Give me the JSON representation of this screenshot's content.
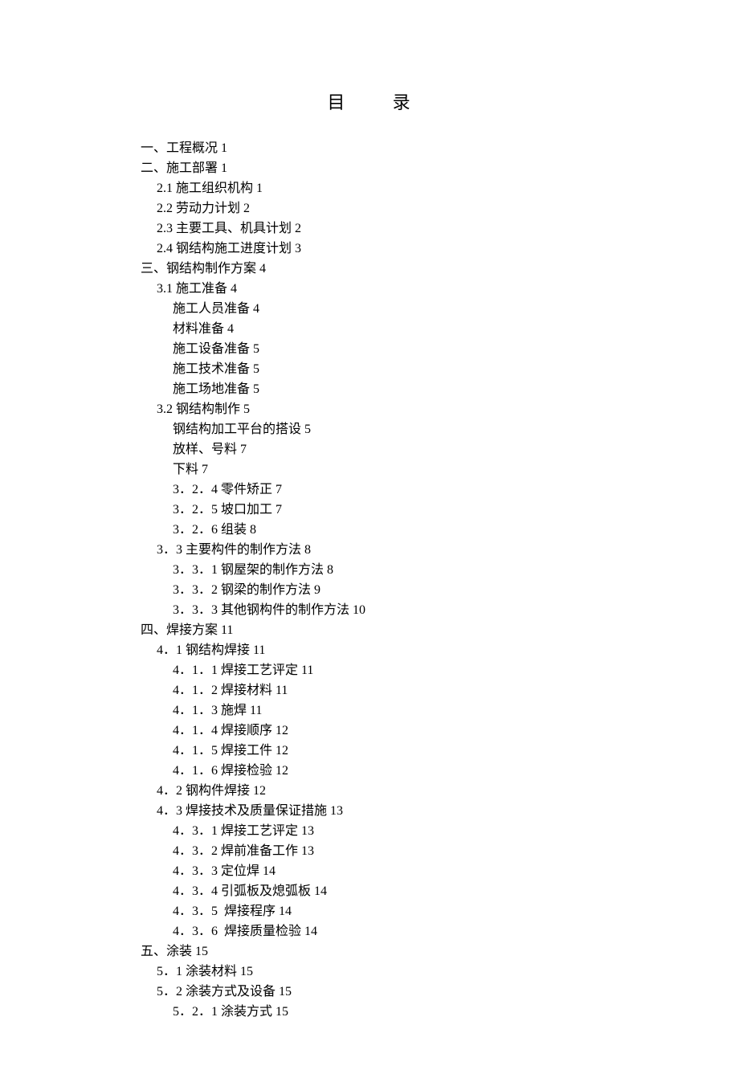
{
  "title_a": "目",
  "title_b": "录",
  "toc": [
    {
      "level": 0,
      "text": "一、工程概况 1"
    },
    {
      "level": 0,
      "text": "二、施工部署 1"
    },
    {
      "level": 1,
      "text": "2.1 施工组织机构 1"
    },
    {
      "level": 1,
      "text": "2.2 劳动力计划 2"
    },
    {
      "level": 1,
      "text": "2.3 主要工具、机具计划 2"
    },
    {
      "level": 1,
      "text": "2.4 钢结构施工进度计划 3"
    },
    {
      "level": 0,
      "text": "三、钢结构制作方案 4"
    },
    {
      "level": 1,
      "text": "3.1 施工准备 4"
    },
    {
      "level": 2,
      "text": "施工人员准备 4"
    },
    {
      "level": 2,
      "text": "材料准备 4"
    },
    {
      "level": 2,
      "text": "施工设备准备 5"
    },
    {
      "level": 2,
      "text": "施工技术准备 5"
    },
    {
      "level": 2,
      "text": "施工场地准备 5"
    },
    {
      "level": 1,
      "text": "3.2 钢结构制作 5"
    },
    {
      "level": 2,
      "text": "钢结构加工平台的搭设 5"
    },
    {
      "level": 2,
      "text": "放样、号料 7"
    },
    {
      "level": 2,
      "text": "下料 7"
    },
    {
      "level": 2,
      "text": "3．2．4 零件矫正 7"
    },
    {
      "level": 2,
      "text": "3．2．5 坡口加工 7"
    },
    {
      "level": 2,
      "text": "3．2．6 组装 8"
    },
    {
      "level": 1,
      "text": "3．3 主要构件的制作方法 8"
    },
    {
      "level": 2,
      "text": "3．3．1 钢屋架的制作方法 8"
    },
    {
      "level": 2,
      "text": "3．3．2 钢梁的制作方法 9"
    },
    {
      "level": 2,
      "text": "3．3．3 其他钢构件的制作方法 10"
    },
    {
      "level": 0,
      "text": "四、焊接方案 11"
    },
    {
      "level": 1,
      "text": "4．1 钢结构焊接 11"
    },
    {
      "level": 2,
      "text": "4．1．1 焊接工艺评定 11"
    },
    {
      "level": 2,
      "text": "4．1．2 焊接材料 11"
    },
    {
      "level": 2,
      "text": "4．1．3 施焊 11"
    },
    {
      "level": 2,
      "text": "4．1．4 焊接顺序 12"
    },
    {
      "level": 2,
      "text": "4．1．5 焊接工件 12"
    },
    {
      "level": 2,
      "text": "4．1．6 焊接检验 12"
    },
    {
      "level": 1,
      "text": "4．2 钢构件焊接 12"
    },
    {
      "level": 1,
      "text": "4．3 焊接技术及质量保证措施 13"
    },
    {
      "level": 2,
      "text": "4．3．1 焊接工艺评定 13"
    },
    {
      "level": 2,
      "text": "4．3．2 焊前准备工作 13"
    },
    {
      "level": 2,
      "text": "4．3．3 定位焊 14"
    },
    {
      "level": 2,
      "text": "4．3．4 引弧板及熄弧板 14"
    },
    {
      "level": 2,
      "text": "4．3．5  焊接程序 14"
    },
    {
      "level": 2,
      "text": "4．3．6  焊接质量检验 14"
    },
    {
      "level": 0,
      "text": "五、涂装 15"
    },
    {
      "level": 1,
      "text": "5．1 涂装材料 15"
    },
    {
      "level": 1,
      "text": "5．2 涂装方式及设备 15"
    },
    {
      "level": 2,
      "text": "5．2．1 涂装方式 15"
    }
  ]
}
